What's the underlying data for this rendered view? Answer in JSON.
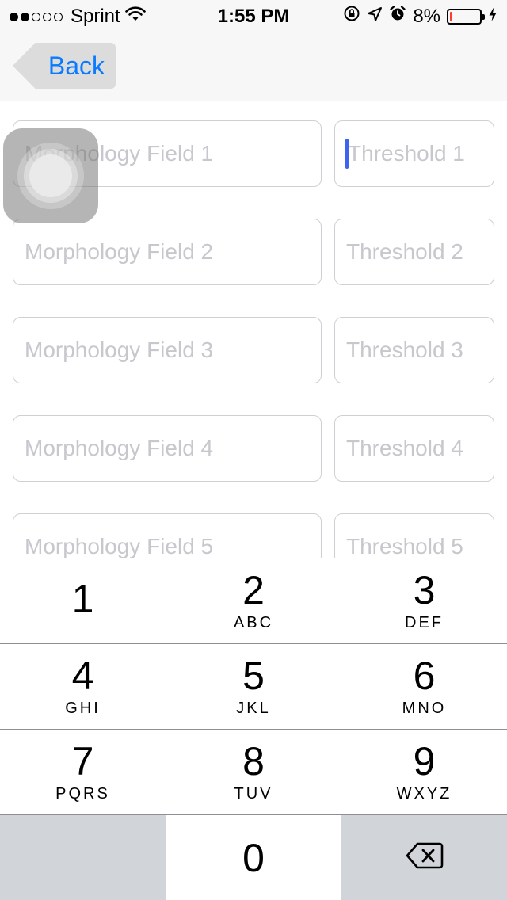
{
  "status_bar": {
    "carrier": "Sprint",
    "time": "1:55 PM",
    "battery_percent_label": "8%",
    "battery_level": 0.08,
    "signal_bars_filled": 2,
    "signal_bars_total": 5,
    "icons": [
      "wifi-icon",
      "rotation-lock-icon",
      "location-arrow-icon",
      "alarm-icon",
      "charging-bolt-icon"
    ]
  },
  "nav": {
    "back_label": "Back"
  },
  "form": {
    "rows": [
      {
        "morphology_placeholder": "Morphology Field 1",
        "threshold_placeholder": "Threshold 1"
      },
      {
        "morphology_placeholder": "Morphology Field 2",
        "threshold_placeholder": "Threshold 2"
      },
      {
        "morphology_placeholder": "Morphology Field 3",
        "threshold_placeholder": "Threshold 3"
      },
      {
        "morphology_placeholder": "Morphology Field 4",
        "threshold_placeholder": "Threshold 4"
      },
      {
        "morphology_placeholder": "Morphology Field 5",
        "threshold_placeholder": "Threshold 5"
      }
    ]
  },
  "keypad": {
    "keys": [
      {
        "digit": "1",
        "letters": ""
      },
      {
        "digit": "2",
        "letters": "ABC"
      },
      {
        "digit": "3",
        "letters": "DEF"
      },
      {
        "digit": "4",
        "letters": "GHI"
      },
      {
        "digit": "5",
        "letters": "JKL"
      },
      {
        "digit": "6",
        "letters": "MNO"
      },
      {
        "digit": "7",
        "letters": "PQRS"
      },
      {
        "digit": "8",
        "letters": "TUV"
      },
      {
        "digit": "9",
        "letters": "WXYZ"
      },
      {
        "digit": "0",
        "letters": ""
      }
    ]
  },
  "colors": {
    "accent": "#0a7aff",
    "placeholder": "#c7c7cd",
    "cursor": "#3e63f0",
    "battery_low": "#ff3b30",
    "keypad_gray": "#d1d4d9"
  }
}
